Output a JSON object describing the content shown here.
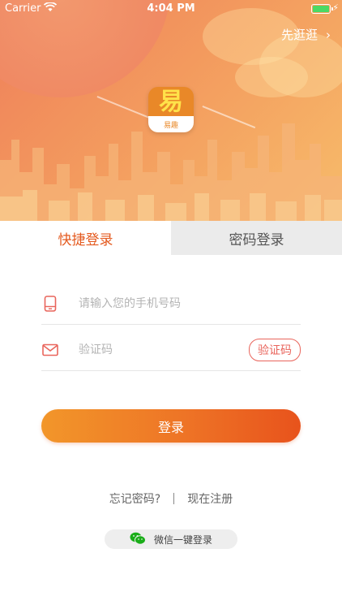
{
  "status_bar": {
    "carrier": "Carrier",
    "time": "4:04 PM",
    "battery_color": "#4cd964"
  },
  "header": {
    "skip_label": "先逛逛",
    "skip_chevron": "›",
    "logo": {
      "glyph": "易",
      "name": "易趣",
      "color": "#e98828"
    }
  },
  "tabs": [
    {
      "label": "快捷登录",
      "active": true
    },
    {
      "label": "密码登录",
      "active": false
    }
  ],
  "form": {
    "phone": {
      "icon": "phone-icon",
      "placeholder": "请输入您的手机号码",
      "value": ""
    },
    "code": {
      "icon": "mail-icon",
      "placeholder": "验证码",
      "value": "",
      "button_label": "验证码"
    },
    "login_label": "登录"
  },
  "links": {
    "forgot": "忘记密码?",
    "register": "现在注册"
  },
  "wechat": {
    "icon": "wechat-icon",
    "label": "微信一键登录",
    "color": "#1aad19"
  },
  "colors": {
    "accent": "#e45a1f",
    "code_button": "#e9655c"
  }
}
